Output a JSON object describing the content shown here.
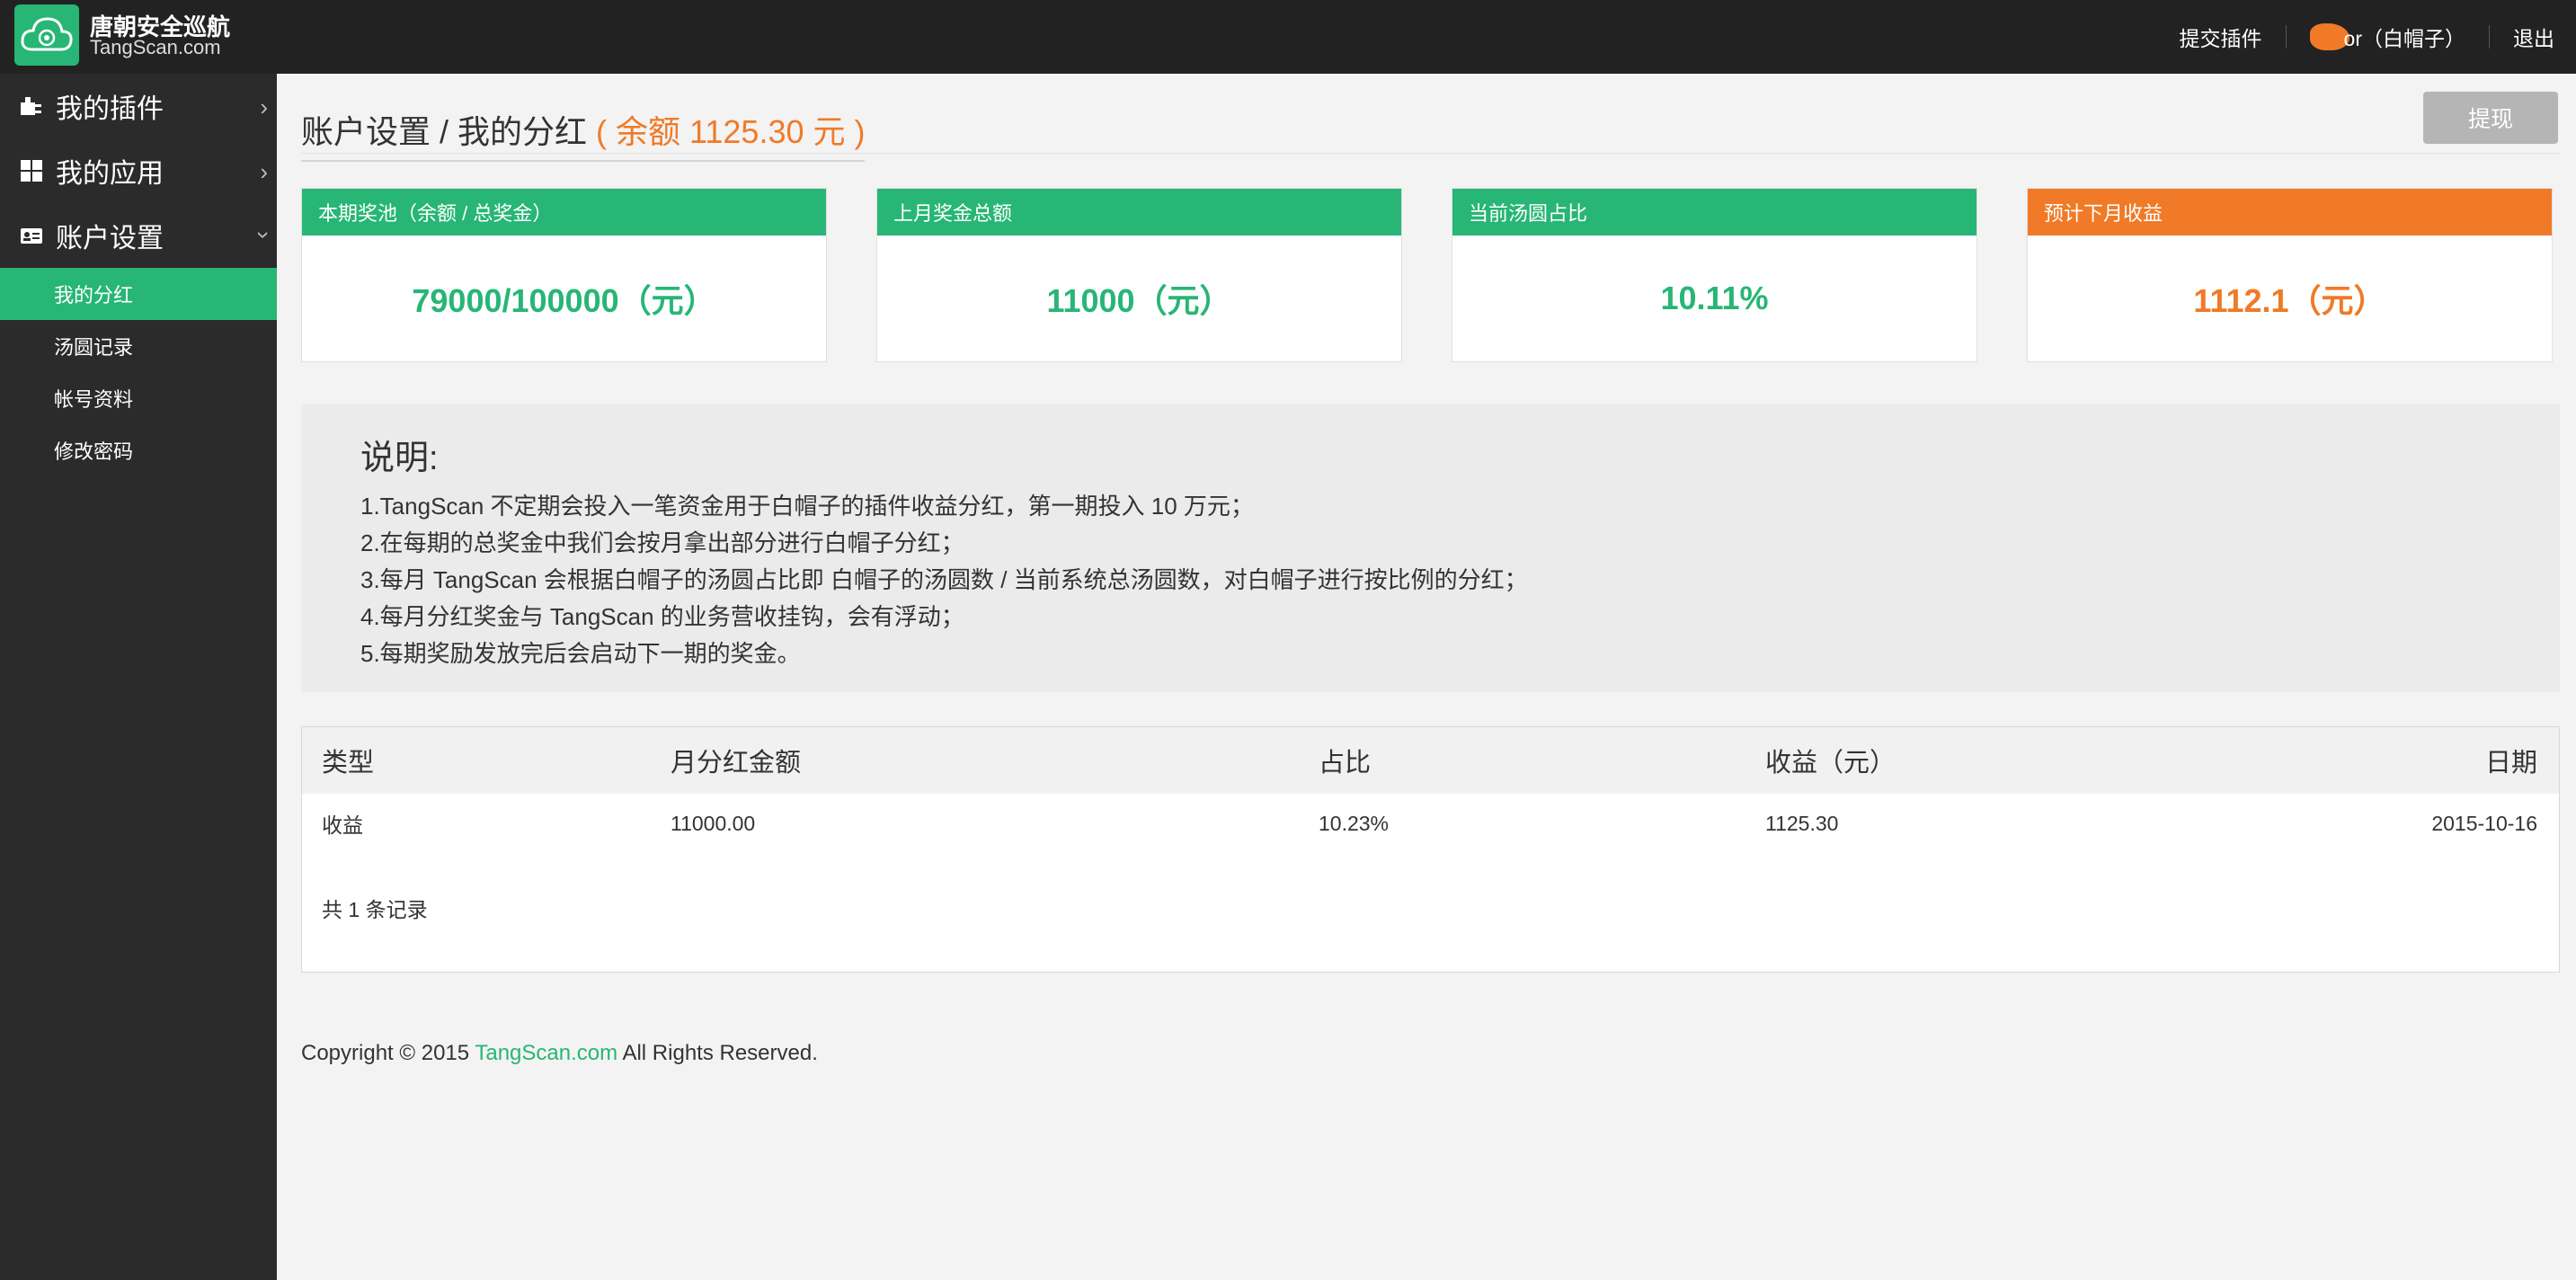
{
  "header": {
    "brand_cn": "唐朝安全巡航",
    "brand_en": "TangScan.com",
    "submit_plugin": "提交插件",
    "user_label": "or（白帽子）",
    "logout": "退出"
  },
  "sidebar": {
    "items": [
      {
        "label": "我的插件",
        "icon": "plug-icon"
      },
      {
        "label": "我的应用",
        "icon": "grid-icon"
      },
      {
        "label": "账户设置",
        "icon": "id-card-icon"
      }
    ],
    "sub_items": [
      {
        "label": "我的分红",
        "active": true
      },
      {
        "label": "汤圆记录",
        "active": false
      },
      {
        "label": "帐号资料",
        "active": false
      },
      {
        "label": "修改密码",
        "active": false
      }
    ]
  },
  "page": {
    "title": "账户设置 / 我的分红",
    "balance": "( 余额 1125.30 元 )",
    "withdraw": "提现"
  },
  "cards": [
    {
      "head": "本期奖池（余额 / 总奖金）",
      "value": "79000/100000（元）",
      "color": "#27b675"
    },
    {
      "head": "上月奖金总额",
      "value": "11000（元）",
      "color": "#27b675"
    },
    {
      "head": "当前汤圆占比",
      "value": "10.11%",
      "color": "#27b675"
    },
    {
      "head": "预计下月收益",
      "value": "1112.1（元）",
      "color": "#f07a27"
    }
  ],
  "notes": {
    "title": "说明:",
    "lines": [
      "1.TangScan 不定期会投入一笔资金用于白帽子的插件收益分红，第一期投入 10 万元；",
      "2.在每期的总奖金中我们会按月拿出部分进行白帽子分红；",
      "3.每月 TangScan 会根据白帽子的汤圆占比即 白帽子的汤圆数 / 当前系统总汤圆数，对白帽子进行按比例的分红；",
      "4.每月分红奖金与 TangScan 的业务营收挂钩，会有浮动；",
      "5.每期奖励发放完后会启动下一期的奖金。"
    ]
  },
  "table": {
    "headers": [
      "类型",
      "月分红金额",
      "占比",
      "收益（元）",
      "日期"
    ],
    "rows": [
      [
        "收益",
        "11000.00",
        "10.23%",
        "1125.30",
        "2015-10-16"
      ]
    ],
    "total": "共 1 条记录"
  },
  "footer": {
    "prefix": "Copyright © 2015 ",
    "link": "TangScan.com",
    "suffix": " All Rights Reserved."
  },
  "colors": {
    "accent": "#27b675",
    "orange": "#f07a27",
    "topbar": "#222222",
    "sidebar": "#2b2b2b"
  }
}
